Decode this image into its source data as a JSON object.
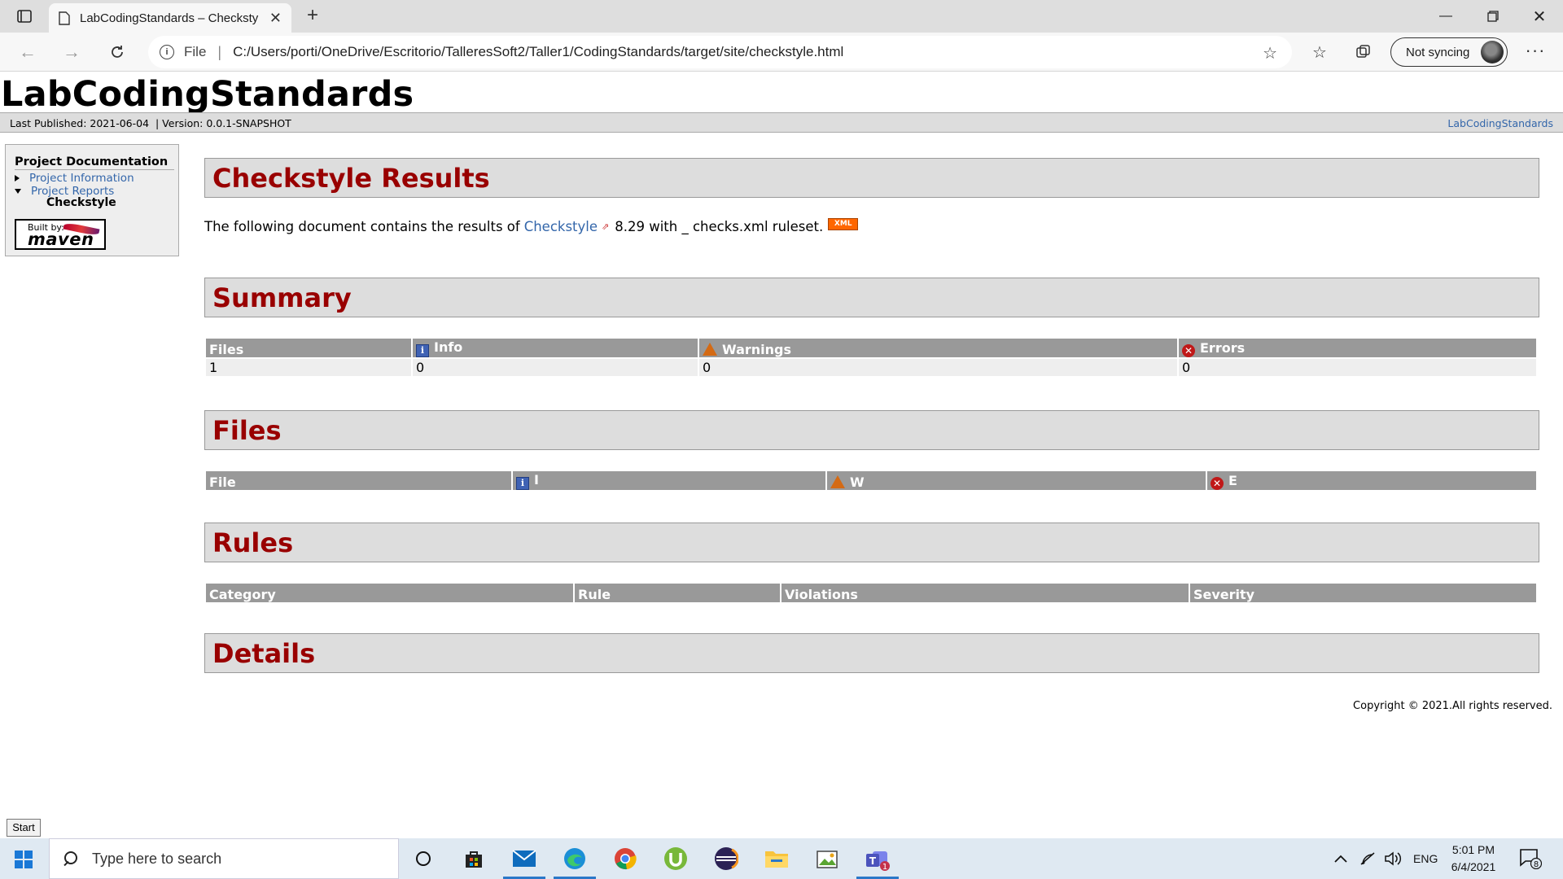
{
  "browser": {
    "tab_title": "LabCodingStandards – Checksty",
    "url_scheme": "File",
    "url": "C:/Users/porti/OneDrive/Escritorio/TalleresSoft2/Taller1/CodingStandards/target/site/checkstyle.html",
    "sync_label": "Not syncing"
  },
  "site": {
    "title": "LabCodingStandards",
    "published": "Last Published: 2021-06-04",
    "version": "| Version: 0.0.1-SNAPSHOT",
    "breadcrumb_right": "LabCodingStandards",
    "nav": {
      "heading": "Project Documentation",
      "items": [
        "Project Information",
        "Project Reports"
      ],
      "current": "Checkstyle",
      "badge_built": "Built by:",
      "badge_word": "maven"
    },
    "sections": {
      "results": "Checkstyle Results",
      "summary": "Summary",
      "files": "Files",
      "rules": "Rules",
      "details": "Details"
    },
    "intro": {
      "before": "The following document contains the results of",
      "link": "Checkstyle",
      "after": "8.29 with _ checks.xml ruleset.",
      "xml_badge": "XML"
    },
    "summary_table": {
      "headers": [
        "Files",
        "Info",
        "Warnings",
        "Errors"
      ],
      "row": [
        "1",
        "0",
        "0",
        "0"
      ]
    },
    "files_table": {
      "headers": [
        "File",
        "I",
        "W",
        "E"
      ]
    },
    "rules_table": {
      "headers": [
        "Category",
        "Rule",
        "Violations",
        "Severity"
      ]
    },
    "copyright": "Copyright © 2021.All rights reserved."
  },
  "taskbar": {
    "start_tooltip": "Start",
    "search_placeholder": "Type here to search",
    "language": "ENG",
    "time": "5:01 PM",
    "date": "6/4/2021",
    "notification_count": "8",
    "teams_badge": "1"
  }
}
